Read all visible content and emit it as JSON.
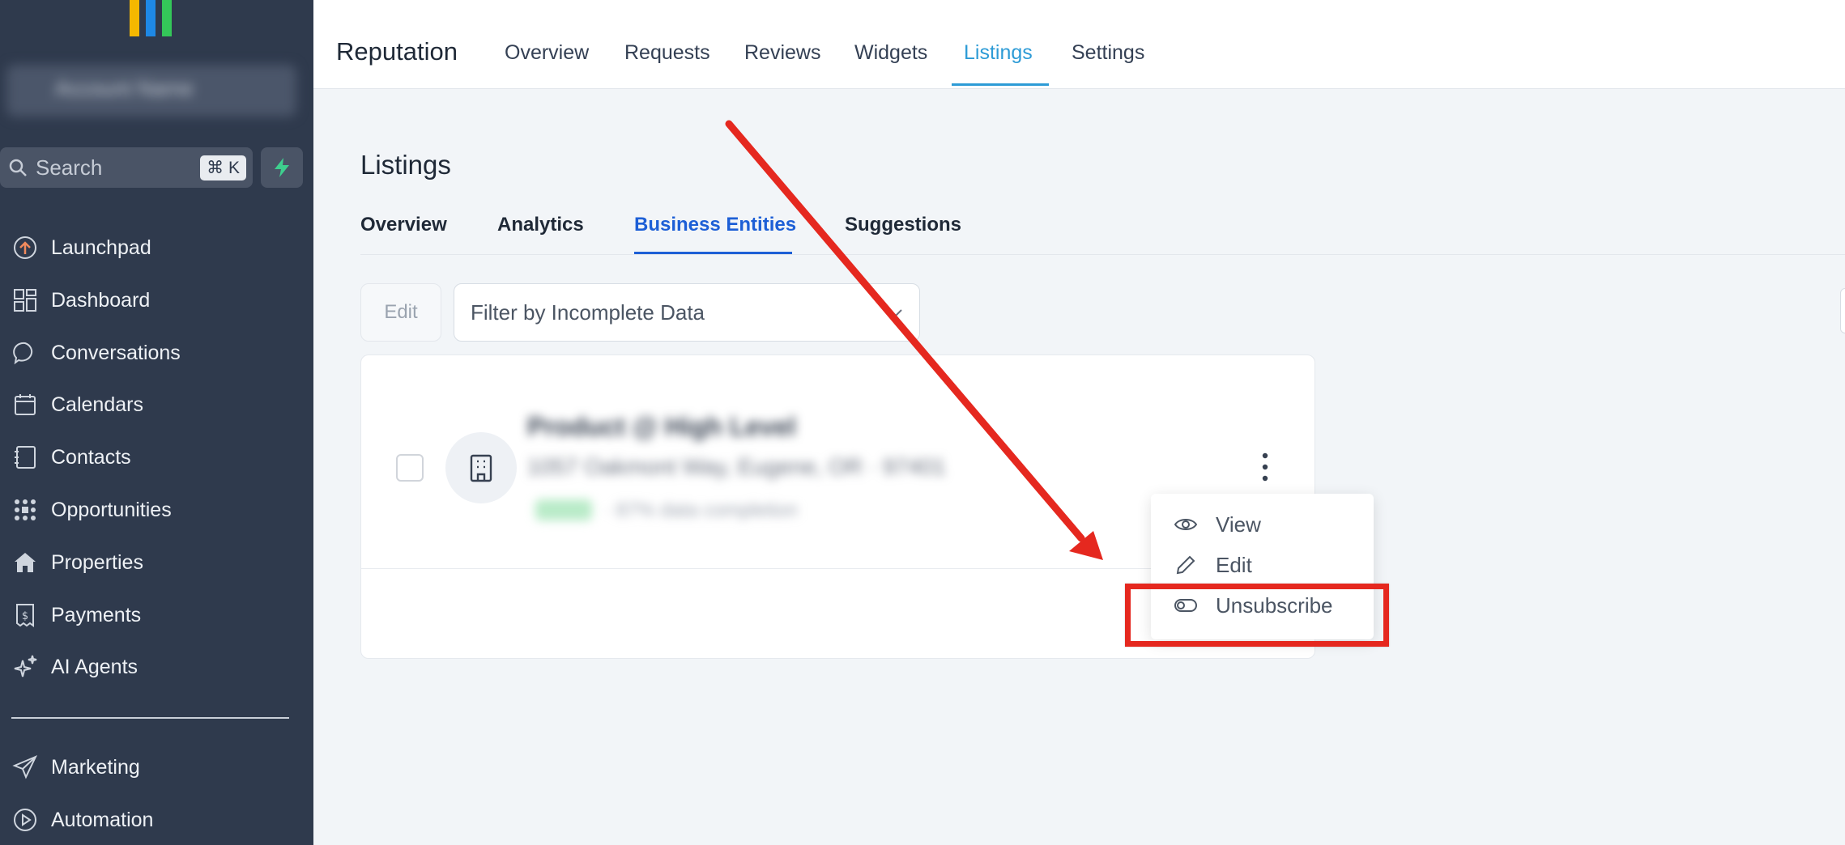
{
  "sidebar": {
    "search_placeholder": "Search",
    "search_shortcut": "⌘ K",
    "items": [
      {
        "label": "Launchpad",
        "icon": "launchpad-icon"
      },
      {
        "label": "Dashboard",
        "icon": "dashboard-icon"
      },
      {
        "label": "Conversations",
        "icon": "chat-icon"
      },
      {
        "label": "Calendars",
        "icon": "calendar-icon"
      },
      {
        "label": "Contacts",
        "icon": "contacts-icon"
      },
      {
        "label": "Opportunities",
        "icon": "opportunities-icon"
      },
      {
        "label": "Properties",
        "icon": "home-icon"
      },
      {
        "label": "Payments",
        "icon": "payments-icon"
      },
      {
        "label": "AI Agents",
        "icon": "sparkle-icon"
      },
      {
        "label": "Marketing",
        "icon": "send-icon"
      },
      {
        "label": "Automation",
        "icon": "play-circle-icon"
      }
    ],
    "colors": {
      "bg": "#2f3a4d",
      "bolt": "#3ecf8e"
    }
  },
  "topbar": {
    "title": "Reputation",
    "tabs": [
      "Overview",
      "Requests",
      "Reviews",
      "Widgets",
      "Listings",
      "Settings"
    ],
    "active_tab": "Listings",
    "accent": "#2d9bd6"
  },
  "listings": {
    "title": "Listings",
    "tabs": [
      "Overview",
      "Analytics",
      "Business Entities",
      "Suggestions"
    ],
    "active_tab": "Business Entities",
    "edit_label": "Edit",
    "filter_placeholder": "Filter by Incomplete Data"
  },
  "menu": {
    "items": [
      {
        "label": "View",
        "icon": "eye-icon"
      },
      {
        "label": "Edit",
        "icon": "pencil-icon"
      },
      {
        "label": "Unsubscribe",
        "icon": "toggle-icon"
      }
    ]
  },
  "annotation": {
    "color": "#e5281f"
  }
}
